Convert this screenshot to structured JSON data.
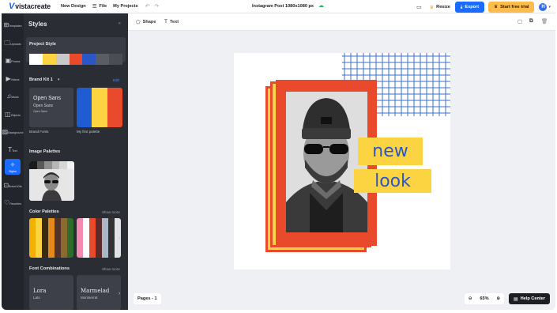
{
  "topbar": {
    "logo": "vistacreate",
    "new_design": "New Design",
    "file": "File",
    "my_projects": "My Projects",
    "doc_title": "Instagram Post 1080x1080 px",
    "resize": "Resize",
    "export": "Export",
    "trial": "Start free trial",
    "avatar_initial": "H"
  },
  "rail": [
    {
      "label": "Templates",
      "icon": "templates-icon",
      "glyph": "⊞"
    },
    {
      "label": "Uploads",
      "icon": "folder-icon",
      "glyph": "🗀"
    },
    {
      "label": "Photos",
      "icon": "photo-icon",
      "glyph": "▣"
    },
    {
      "label": "Videos",
      "icon": "video-icon",
      "glyph": "▶"
    },
    {
      "label": "Music",
      "icon": "music-icon",
      "glyph": "♫"
    },
    {
      "label": "Objects",
      "icon": "objects-icon",
      "glyph": "◫"
    },
    {
      "label": "Background",
      "icon": "background-icon",
      "glyph": "▨"
    },
    {
      "label": "Text",
      "icon": "text-icon",
      "glyph": "T"
    },
    {
      "label": "Styles",
      "icon": "styles-icon",
      "glyph": "✧"
    },
    {
      "label": "Brand Kits",
      "icon": "brand-kit-icon",
      "glyph": "⊡"
    },
    {
      "label": "Favorites",
      "icon": "heart-icon",
      "glyph": "♡"
    }
  ],
  "panel": {
    "title": "Styles",
    "project_style": "Project Style",
    "project_colors": [
      "#ffffff",
      "#fcd340",
      "#c9c9c9",
      "#ea4a2c",
      "#2a56c6",
      "#5a5d63",
      "#4a4d52"
    ],
    "brand_kit": "Brand Kit 1",
    "edit": "Edit",
    "font_card": {
      "big": "Open Sans",
      "mid": "Open Sans",
      "small": "Open Sans"
    },
    "brand_fonts": "Brand Fonts",
    "palette_colors": [
      "#1f5bd1",
      "#fcd340",
      "#ea4a2c"
    ],
    "my_palette": "My first palette",
    "image_palettes": "Image Palettes",
    "image_swatches": [
      "#1b1b1b",
      "#5a5a5a",
      "#8f8f8f",
      "#b7b7b7",
      "#d7d7d7",
      "#f2f2f2"
    ],
    "color_palettes": "Color Palettes",
    "show_more": "Show more",
    "palette_a": [
      "#f2b000",
      "#fcd340",
      "#3a2a10",
      "#e48a1a",
      "#52332a",
      "#8a6a2f",
      "#2f6b2a"
    ],
    "palette_b": [
      "#f28bb0",
      "#ffffff",
      "#ea4a2c",
      "#5b2b2b",
      "#a9b7c9",
      "#333333",
      "#e1e3e6"
    ],
    "font_combinations": "Font Combinations",
    "show_more_2": "Show more",
    "combo_a": {
      "title": "Lora",
      "sub": "Lato"
    },
    "combo_b": {
      "title": "Marmelad",
      "sub": "Montserrat"
    }
  },
  "canvas": {
    "shape": "Shape",
    "text": "Text",
    "word1": "new",
    "word2": "look",
    "pages": "Pages - 1",
    "zoom": "65%",
    "help": "Help Center",
    "colors": {
      "accent": "#1a6bff",
      "frame": "#ea4a2c",
      "yellow": "#fcd340",
      "blue": "#2a56c6"
    }
  }
}
